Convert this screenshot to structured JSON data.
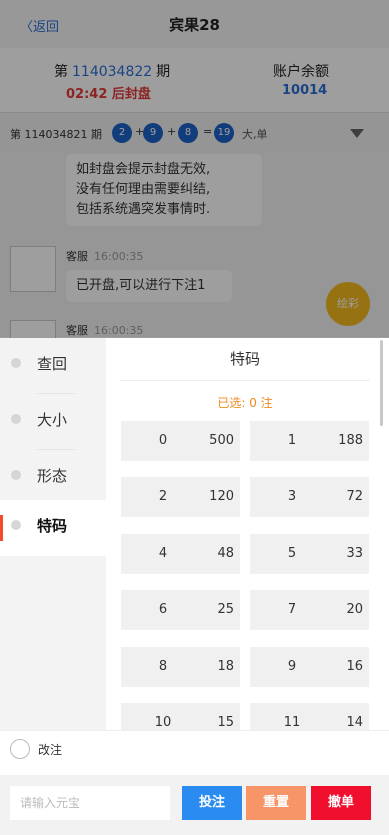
{
  "header": {
    "back_label": "〈返回",
    "title": "宾果28"
  },
  "issue": {
    "prefix": "第",
    "number": "114034822",
    "suffix": "期",
    "countdown": "02:42",
    "status": "后封盘",
    "balance_label": "账户余额",
    "balance_value": "10014"
  },
  "last_result": {
    "label": "第 114034821 期",
    "balls": [
      "2",
      "9",
      "8",
      "19"
    ],
    "tags": "大,单"
  },
  "chat": {
    "notice_lines": [
      "如封盘会提示封盘无效,",
      "没有任何理由需要纠结,",
      "包括系统遇突发事情时."
    ],
    "messages": [
      {
        "sender": "客服",
        "time": "16:00:35",
        "text": "已开盘,可以进行下注1"
      },
      {
        "sender": "客服",
        "time": "16:00:35",
        "text": ""
      }
    ],
    "color_badge": "绘彩"
  },
  "categories": [
    {
      "label": "查回"
    },
    {
      "label": "大小"
    },
    {
      "label": "形态"
    },
    {
      "label": "特码",
      "active": true
    }
  ],
  "panel": {
    "title": "特码",
    "selected_text": "已选: 0 注",
    "options": [
      {
        "num": "0",
        "odds": "500"
      },
      {
        "num": "1",
        "odds": "188"
      },
      {
        "num": "2",
        "odds": "120"
      },
      {
        "num": "3",
        "odds": "72"
      },
      {
        "num": "4",
        "odds": "48"
      },
      {
        "num": "5",
        "odds": "33"
      },
      {
        "num": "6",
        "odds": "25"
      },
      {
        "num": "7",
        "odds": "20"
      },
      {
        "num": "8",
        "odds": "18"
      },
      {
        "num": "9",
        "odds": "16"
      },
      {
        "num": "10",
        "odds": "15"
      },
      {
        "num": "11",
        "odds": "14"
      }
    ]
  },
  "footer": {
    "modify_label": "改注",
    "amount_placeholder": "请输入元宝",
    "bet_label": "投注",
    "reset_label": "重置",
    "cancel_label": "撤单"
  },
  "colors": {
    "accent_blue": "#2a8cf0",
    "reset_orange": "#f79468",
    "cancel_red": "#f0102e",
    "ball_blue": "#1e63c9",
    "selected_orange": "#f0891e"
  }
}
